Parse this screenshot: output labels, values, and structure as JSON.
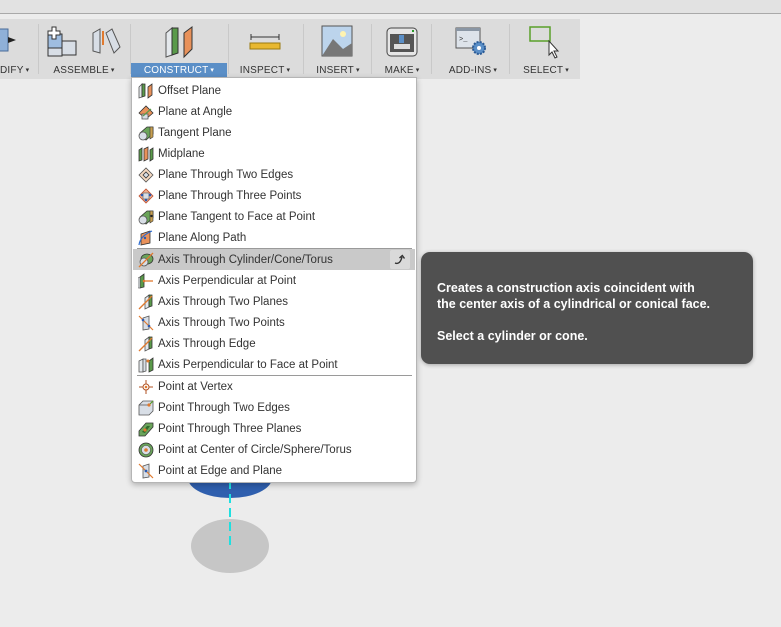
{
  "toolbar": {
    "groups": [
      {
        "id": "modify",
        "label": "DIFY",
        "icon": "modify-icon"
      },
      {
        "id": "assemble",
        "label": "ASSEMBLE",
        "icon": "assemble-icon"
      },
      {
        "id": "construct",
        "label": "CONSTRUCT",
        "icon": "construct-icon",
        "active": true
      },
      {
        "id": "inspect",
        "label": "INSPECT",
        "icon": "ruler-icon"
      },
      {
        "id": "insert",
        "label": "INSERT",
        "icon": "image-icon"
      },
      {
        "id": "make",
        "label": "MAKE",
        "icon": "printer-icon"
      },
      {
        "id": "addins",
        "label": "ADD-INS",
        "icon": "scripts-gear-icon"
      },
      {
        "id": "select",
        "label": "SELECT",
        "icon": "select-box-icon"
      }
    ],
    "caret": "▾"
  },
  "construct_menu": {
    "sections": [
      {
        "items": [
          {
            "label": "Offset Plane",
            "icon": "offset-plane-icon"
          },
          {
            "label": "Plane at Angle",
            "icon": "plane-at-angle-icon"
          },
          {
            "label": "Tangent Plane",
            "icon": "tangent-plane-icon"
          },
          {
            "label": "Midplane",
            "icon": "midplane-icon"
          },
          {
            "label": "Plane Through Two Edges",
            "icon": "plane-two-edges-icon"
          },
          {
            "label": "Plane Through Three Points",
            "icon": "plane-three-points-icon"
          },
          {
            "label": "Plane Tangent to Face at Point",
            "icon": "plane-tangent-face-point-icon"
          },
          {
            "label": "Plane Along Path",
            "icon": "plane-along-path-icon"
          }
        ]
      },
      {
        "items": [
          {
            "label": "Axis Through Cylinder/Cone/Torus",
            "icon": "axis-cylinder-icon",
            "highlighted": true
          },
          {
            "label": "Axis Perpendicular at Point",
            "icon": "axis-perpendicular-point-icon"
          },
          {
            "label": "Axis Through Two Planes",
            "icon": "axis-two-planes-icon"
          },
          {
            "label": "Axis Through Two Points",
            "icon": "axis-two-points-icon"
          },
          {
            "label": "Axis Through Edge",
            "icon": "axis-edge-icon"
          },
          {
            "label": "Axis Perpendicular to Face at Point",
            "icon": "axis-perpendicular-face-icon"
          }
        ]
      },
      {
        "items": [
          {
            "label": "Point at Vertex",
            "icon": "point-vertex-icon"
          },
          {
            "label": "Point Through Two Edges",
            "icon": "point-two-edges-icon"
          },
          {
            "label": "Point Through Three Planes",
            "icon": "point-three-planes-icon"
          },
          {
            "label": "Point at Center of Circle/Sphere/Torus",
            "icon": "point-center-icon"
          },
          {
            "label": "Point at Edge and Plane",
            "icon": "point-edge-plane-icon"
          }
        ]
      }
    ]
  },
  "tooltip": {
    "line1": "Creates a construction axis coincident with",
    "line2": "the center axis of a cylindrical or conical face.",
    "line3": "Select a cylinder or cone."
  },
  "colors": {
    "active_tab": "#5b8fc7",
    "highlight_row": "#c9c9c9",
    "tooltip_bg": "#505050",
    "cylinder_blue": "#2f5fae",
    "axis_cyan": "#1ee0e0"
  }
}
